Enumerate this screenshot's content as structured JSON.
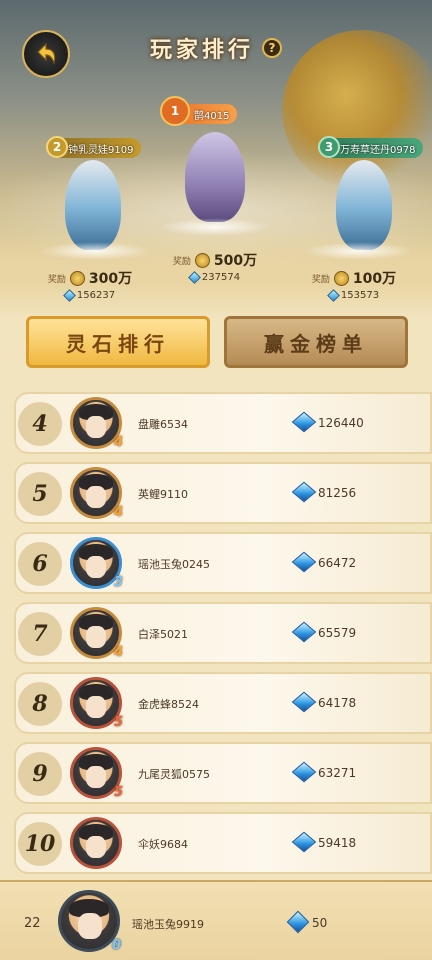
{
  "header": {
    "title": "玩家排行",
    "help_icon": "question-mark-icon",
    "back_icon": "back-arrow-icon"
  },
  "podium": [
    {
      "rank": "1",
      "name": "鹊4015",
      "reward_label": "奖励",
      "reward": "500万",
      "score": "237574",
      "badge_color": "#e8762b"
    },
    {
      "rank": "2",
      "name": "钟乳灵娃9109",
      "reward_label": "奖励",
      "reward": "300万",
      "score": "156237",
      "badge_color": "#c59a2c"
    },
    {
      "rank": "3",
      "name": "万寿草还丹0978",
      "reward_label": "奖励",
      "reward": "100万",
      "score": "153573",
      "badge_color": "#3f9a6e"
    }
  ],
  "tabs": {
    "active": "灵石排行",
    "inactive": "赢金榜单"
  },
  "rows": [
    {
      "rank": "4",
      "name": "盘雕6534",
      "score": "126440",
      "level": "4"
    },
    {
      "rank": "5",
      "name": "英鲤9110",
      "score": "81256",
      "level": "4"
    },
    {
      "rank": "6",
      "name": "瑶池玉兔0245",
      "score": "66472",
      "level": "3"
    },
    {
      "rank": "7",
      "name": "白泽5021",
      "score": "65579",
      "level": "4"
    },
    {
      "rank": "8",
      "name": "金虎蜂8524",
      "score": "64178",
      "level": "5"
    },
    {
      "rank": "9",
      "name": "九尾灵狐0575",
      "score": "63271",
      "level": "5"
    },
    {
      "rank": "10",
      "name": "伞妖9684",
      "score": "59418",
      "level": ""
    }
  ],
  "me": {
    "rank": "22",
    "name": "瑶池玉兔9919",
    "score": "50",
    "level": "0"
  }
}
